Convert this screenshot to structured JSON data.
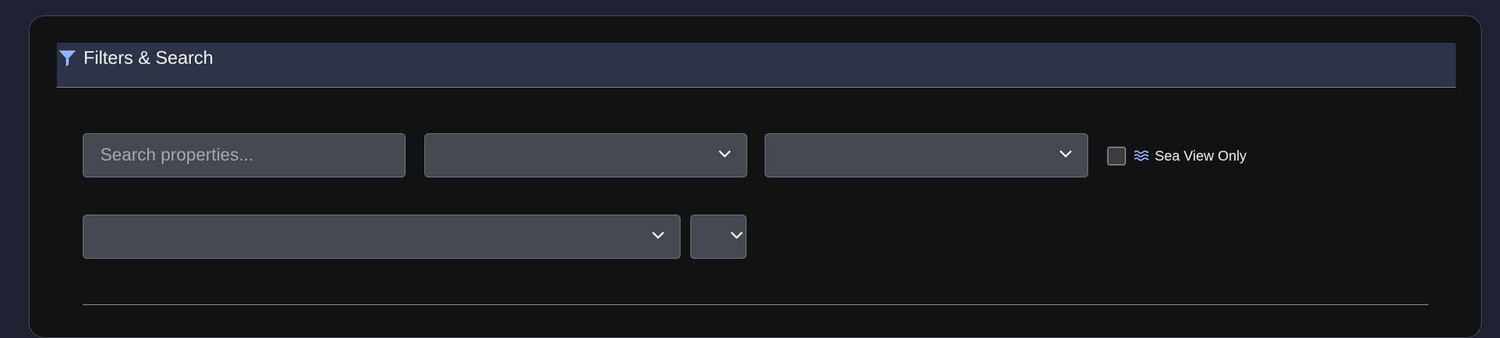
{
  "filters": {
    "title": "Filters & Search",
    "icon": "filter-icon",
    "search": {
      "placeholder": "Search properties...",
      "value": ""
    },
    "selects": {
      "first": {
        "value": ""
      },
      "second": {
        "value": ""
      },
      "sort": {
        "value": ""
      },
      "order": {
        "value": ""
      }
    },
    "sea_view": {
      "label": "Sea View Only",
      "checked": false,
      "icon": "waves-icon"
    }
  },
  "colors": {
    "page_bg": "#1e2230",
    "panel_bg": "#111214",
    "header_bg": "#2d3347",
    "field_bg": "#45484f",
    "accent": "#8fb4ff"
  }
}
